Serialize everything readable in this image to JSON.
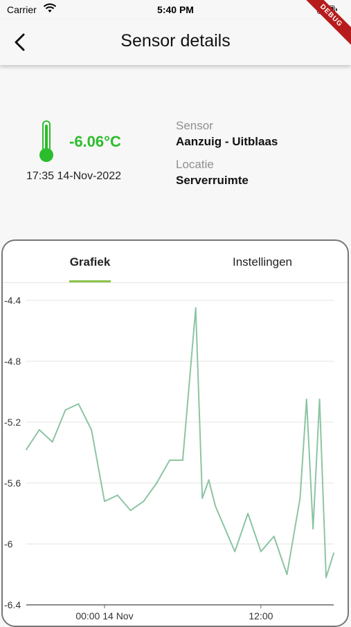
{
  "status_bar": {
    "carrier": "Carrier",
    "time": "5:40 PM",
    "icons": [
      "wifi-icon",
      "battery-icon"
    ]
  },
  "debug_banner": "DEBUG",
  "app_bar": {
    "title": "Sensor details",
    "back_icon": "chevron-left-icon"
  },
  "sensor": {
    "temperature": "-6.06°C",
    "temperature_color": "#2bbd2b",
    "timestamp": "17:35 14-Nov-2022",
    "sensor_label": "Sensor",
    "sensor_name": "Aanzuig - Uitblaas",
    "location_label": "Locatie",
    "location_name": "Serverruimte",
    "icon": "thermometer-icon"
  },
  "tabs": [
    {
      "label": "Grafiek",
      "active": true
    },
    {
      "label": "Instellingen",
      "active": false
    }
  ],
  "accent_color": "#8bc34a",
  "chart_data": {
    "type": "line",
    "title": "",
    "xlabel": "",
    "ylabel": "",
    "series_color": "#8cc4a2",
    "x_ticks": [
      "00:00 14 Nov",
      "12:00"
    ],
    "y_ticks": [
      "-4.4",
      "-4.8",
      "-5.2",
      "-5.6",
      "-6",
      "-6.4"
    ],
    "ylim": [
      -6.4,
      -4.4
    ],
    "grid": "horizontal",
    "x": [
      "2022-11-13 18:00",
      "2022-11-13 19:00",
      "2022-11-13 20:00",
      "2022-11-13 21:00",
      "2022-11-13 22:00",
      "2022-11-13 23:00",
      "2022-11-14 00:00",
      "2022-11-14 01:00",
      "2022-11-14 02:00",
      "2022-11-14 03:00",
      "2022-11-14 04:00",
      "2022-11-14 05:00",
      "2022-11-14 06:00",
      "2022-11-14 07:00",
      "2022-11-14 07:30",
      "2022-11-14 08:00",
      "2022-11-14 08:30",
      "2022-11-14 09:00",
      "2022-11-14 10:00",
      "2022-11-14 11:00",
      "2022-11-14 12:00",
      "2022-11-14 13:00",
      "2022-11-14 14:00",
      "2022-11-14 15:00",
      "2022-11-14 15:30",
      "2022-11-14 16:00",
      "2022-11-14 16:30",
      "2022-11-14 17:00",
      "2022-11-14 17:35"
    ],
    "values": [
      -5.38,
      -5.25,
      -5.33,
      -5.12,
      -5.08,
      -5.25,
      -5.72,
      -5.68,
      -5.78,
      -5.72,
      -5.6,
      -5.45,
      -5.45,
      -4.45,
      -5.7,
      -5.58,
      -5.75,
      -5.85,
      -6.05,
      -5.8,
      -6.05,
      -5.95,
      -6.2,
      -5.7,
      -5.05,
      -5.9,
      -5.05,
      -6.22,
      -6.06
    ]
  }
}
